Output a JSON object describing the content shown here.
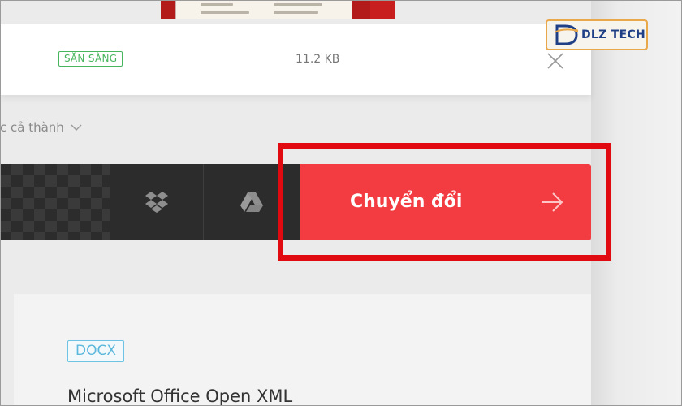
{
  "file": {
    "status": "SẴN SÀNG",
    "size": "11.2 KB"
  },
  "to_format": {
    "label": "c cả thành"
  },
  "actions": {
    "convert_label": "Chuyển đổi",
    "icons": [
      "dropbox-icon",
      "google-drive-icon",
      "arrow-right-icon"
    ]
  },
  "format_info": {
    "badge": "DOCX",
    "name": "Microsoft Office Open XML"
  },
  "watermark": {
    "text": "DLZ TECH"
  },
  "colors": {
    "convert_button": "#f23c42",
    "status_green": "#47b55d",
    "highlight_red": "#e00a10",
    "format_badge_blue": "#5bb8dc"
  }
}
